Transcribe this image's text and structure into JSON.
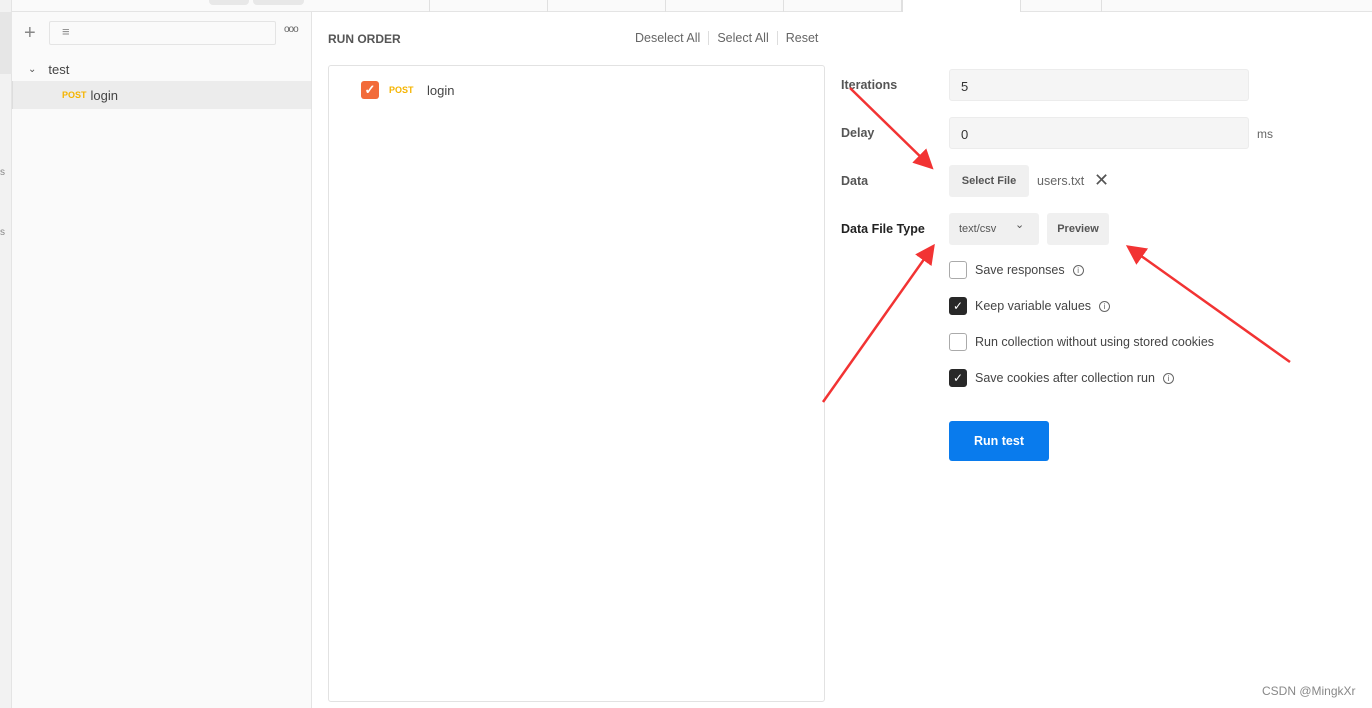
{
  "sidebar": {
    "folder": "test",
    "request": {
      "method": "POST",
      "name": "login"
    },
    "strip_letters": [
      "s",
      "s"
    ]
  },
  "run_order": {
    "title": "RUN ORDER",
    "deselect_all": "Deselect All",
    "select_all": "Select All",
    "reset": "Reset",
    "items": [
      {
        "method": "POST",
        "name": "login",
        "checked": true
      }
    ]
  },
  "settings": {
    "iterations_label": "Iterations",
    "iterations": "5",
    "delay_label": "Delay",
    "delay": "0",
    "delay_unit": "ms",
    "data_label": "Data",
    "select_file": "Select File",
    "file_name": "users.txt",
    "file_type_label": "Data File Type",
    "file_type": "text/csv",
    "preview": "Preview",
    "options": [
      {
        "label": "Save responses",
        "checked": false,
        "info": true
      },
      {
        "label": "Keep variable values",
        "checked": true,
        "info": true
      },
      {
        "label": "Run collection without using stored cookies",
        "checked": false,
        "info": false
      },
      {
        "label": "Save cookies after collection run",
        "checked": true,
        "info": true
      }
    ],
    "run_button": "Run test"
  },
  "colors": {
    "accent": "#097bed",
    "post": "#f5b400",
    "checkbox_orange": "#f26b3a",
    "annotation": "#f23333"
  },
  "watermark": "CSDN @MingkXr"
}
